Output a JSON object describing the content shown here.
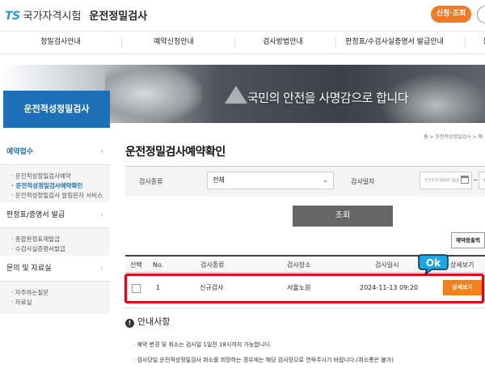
{
  "header": {
    "logo_ts": "TS",
    "logo_name": "국가자격시험",
    "logo_title": "운전정밀검사",
    "apply_button": "신청·조회"
  },
  "gnb": {
    "items": [
      "정밀검사안내",
      "예약신청안내",
      "검사방법안내",
      "판정표/수검사실증명서 발급안내",
      "문"
    ]
  },
  "hero": {
    "slogan": "국민의 안전을 사명감으로 합니다"
  },
  "sidebar": {
    "title": "운전적성정밀검사",
    "groups": [
      {
        "label": "예약접수",
        "active": true,
        "items": [
          "운전적성정밀검사예약",
          "운전적성정밀검사예약확인",
          "운전적성정밀검사 알림문자 서비스"
        ]
      },
      {
        "label": "판정표/증명서 발급",
        "active": false,
        "items": [
          "종합판정표재발급",
          "수검사실증명서발급"
        ]
      },
      {
        "label": "문의 및 자료실",
        "active": false,
        "items": [
          "자주하는질문",
          "자료실"
        ]
      }
    ]
  },
  "breadcrumb": "홈  >  운전적성정밀검사  >  예",
  "page_title": "운전정밀검사예약확인",
  "search": {
    "type_label": "검사종류",
    "type_value": "전체",
    "date_label": "검사일자",
    "date_placeholder": "YYYY-MM-dd",
    "date_tilde": "~",
    "date_placeholder2": "YYYY-MM-dd",
    "search_button": "조회"
  },
  "print_button": "예약증출력",
  "table": {
    "headers": [
      "선택",
      "No.",
      "검사종류",
      "검사장소",
      "검사일시",
      "상세보기"
    ],
    "rows": [
      {
        "no": "1",
        "type": "신규검사",
        "place": "서울노원",
        "datetime": "2024-11-13 09:20",
        "detail": "상세보기"
      }
    ]
  },
  "ok_badge": "Ok",
  "info": {
    "title": "안내사항",
    "lines": [
      "· 예약 변경 및 취소는 검사일 1일전 18시까지 가능합니다.",
      "· 검사당일 운전적성정밀검사 취소를 희망하는 경우에는 해당 검사장으로 연락주시기 바랍니다.(취소통은 불가)"
    ]
  }
}
